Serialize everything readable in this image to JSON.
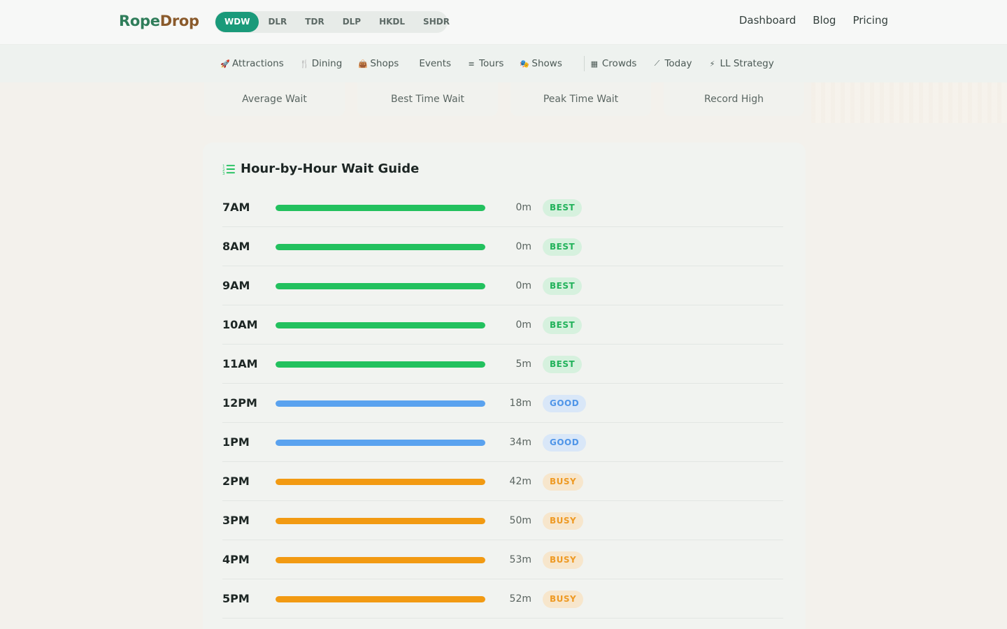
{
  "brand": {
    "part1": "Rope",
    "part2": "Drop"
  },
  "parks": [
    {
      "label": "WDW",
      "active": true
    },
    {
      "label": "DLR",
      "active": false
    },
    {
      "label": "TDR",
      "active": false
    },
    {
      "label": "DLP",
      "active": false
    },
    {
      "label": "HKDL",
      "active": false
    },
    {
      "label": "SHDR",
      "active": false
    }
  ],
  "topnav": [
    "Dashboard",
    "Blog",
    "Pricing"
  ],
  "subnav": {
    "left": [
      {
        "icon": "rocket-icon",
        "glyph": "🚀",
        "label": "Attractions"
      },
      {
        "icon": "utensils-icon",
        "glyph": "🍴",
        "label": "Dining"
      },
      {
        "icon": "bag-icon",
        "glyph": "👜",
        "label": "Shops"
      },
      {
        "icon": "",
        "glyph": "",
        "label": "Events"
      },
      {
        "icon": "signpost-icon",
        "glyph": "≡",
        "label": "Tours"
      },
      {
        "icon": "masks-icon",
        "glyph": "🎭",
        "label": "Shows"
      }
    ],
    "right": [
      {
        "icon": "calendar-icon",
        "glyph": "▦",
        "label": "Crowds"
      },
      {
        "icon": "chart-line-icon",
        "glyph": "⟋",
        "label": "Today"
      },
      {
        "icon": "bolt-icon",
        "glyph": "⚡",
        "label": "LL Strategy"
      }
    ]
  },
  "stats": [
    "Average Wait",
    "Best Time Wait",
    "Peak Time Wait",
    "Record High"
  ],
  "guide": {
    "title": "Hour-by-Hour Wait Guide",
    "rows": [
      {
        "hour": "7AM",
        "wait": "0m",
        "badge": "BEST",
        "level": 1.0
      },
      {
        "hour": "8AM",
        "wait": "0m",
        "badge": "BEST",
        "level": 1.0
      },
      {
        "hour": "9AM",
        "wait": "0m",
        "badge": "BEST",
        "level": 1.0
      },
      {
        "hour": "10AM",
        "wait": "0m",
        "badge": "BEST",
        "level": 1.0
      },
      {
        "hour": "11AM",
        "wait": "5m",
        "badge": "BEST",
        "level": 1.0
      },
      {
        "hour": "12PM",
        "wait": "18m",
        "badge": "GOOD",
        "level": 1.0
      },
      {
        "hour": "1PM",
        "wait": "34m",
        "badge": "GOOD",
        "level": 1.0
      },
      {
        "hour": "2PM",
        "wait": "42m",
        "badge": "BUSY",
        "level": 1.0
      },
      {
        "hour": "3PM",
        "wait": "50m",
        "badge": "BUSY",
        "level": 1.0
      },
      {
        "hour": "4PM",
        "wait": "53m",
        "badge": "BUSY",
        "level": 1.0
      },
      {
        "hour": "5PM",
        "wait": "52m",
        "badge": "BUSY",
        "level": 1.0
      },
      {
        "hour": "",
        "wait": "",
        "badge": "",
        "level": 1.0
      }
    ]
  },
  "colors": {
    "accent": "#1a9a7a",
    "best_bar": "#22c15e",
    "best_badge_bg": "#d6f1de",
    "best_badge_text": "#21b25a",
    "good_bar": "#5aa2ef",
    "good_badge_bg": "#d9e7f8",
    "good_badge_text": "#4f95e8",
    "busy_bar": "#f29a12",
    "busy_badge_bg": "#f7e6cc",
    "busy_badge_text": "#ee9a24"
  }
}
